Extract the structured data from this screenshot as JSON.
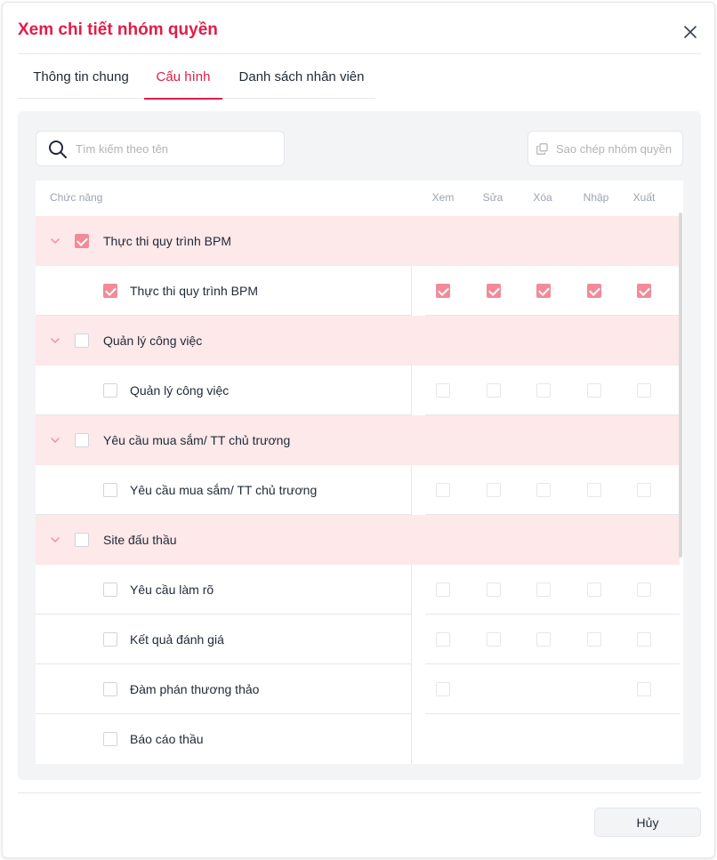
{
  "modal": {
    "title": "Xem chi tiết nhóm quyền",
    "cancel_label": "Hủy"
  },
  "tabs": [
    {
      "label": "Thông tin chung",
      "active": false
    },
    {
      "label": "Cấu hình",
      "active": true
    },
    {
      "label": "Danh sách nhân viên",
      "active": false
    }
  ],
  "search": {
    "placeholder": "Tìm kiếm theo tên",
    "value": ""
  },
  "copy_button": {
    "label": "Sao chép nhóm quyền",
    "icon": "copy-icon"
  },
  "table": {
    "columns": {
      "function": "Chức năng",
      "permissions": [
        "Xem",
        "Sửa",
        "Xóa",
        "Nhập",
        "Xuất"
      ]
    },
    "rows": [
      {
        "type": "group",
        "label": "Thực thi quy trình BPM",
        "checked": true
      },
      {
        "type": "item",
        "label": "Thực thi quy trình BPM",
        "checked": true,
        "perms": [
          true,
          true,
          true,
          true,
          true
        ]
      },
      {
        "type": "group",
        "label": "Quản lý công việc",
        "checked": false
      },
      {
        "type": "item",
        "label": "Quản lý công việc",
        "checked": false,
        "perms": [
          false,
          false,
          false,
          false,
          false
        ]
      },
      {
        "type": "group",
        "label": "Yêu cầu mua sắm/ TT chủ trương",
        "checked": false
      },
      {
        "type": "item",
        "label": "Yêu cầu mua sắm/ TT chủ trương",
        "checked": false,
        "perms": [
          false,
          false,
          false,
          false,
          false
        ]
      },
      {
        "type": "group",
        "label": "Site đấu thầu",
        "checked": false
      },
      {
        "type": "item",
        "label": "Yêu cầu làm rõ",
        "checked": false,
        "perms": [
          false,
          false,
          false,
          false,
          false
        ]
      },
      {
        "type": "item",
        "label": "Kết quả đánh giá",
        "checked": false,
        "perms": [
          false,
          false,
          false,
          false,
          false
        ]
      },
      {
        "type": "item",
        "label": "Đàm phán thương thảo",
        "checked": false,
        "perms": [
          false,
          null,
          null,
          null,
          false
        ]
      },
      {
        "type": "item",
        "label": "Báo cáo thầu",
        "checked": false,
        "perms": [
          null,
          null,
          null,
          null,
          null
        ]
      }
    ]
  },
  "colors": {
    "accent": "#e11d48",
    "group_row_bg": "#fde8ea",
    "checkbox_checked": "#f28b99"
  }
}
